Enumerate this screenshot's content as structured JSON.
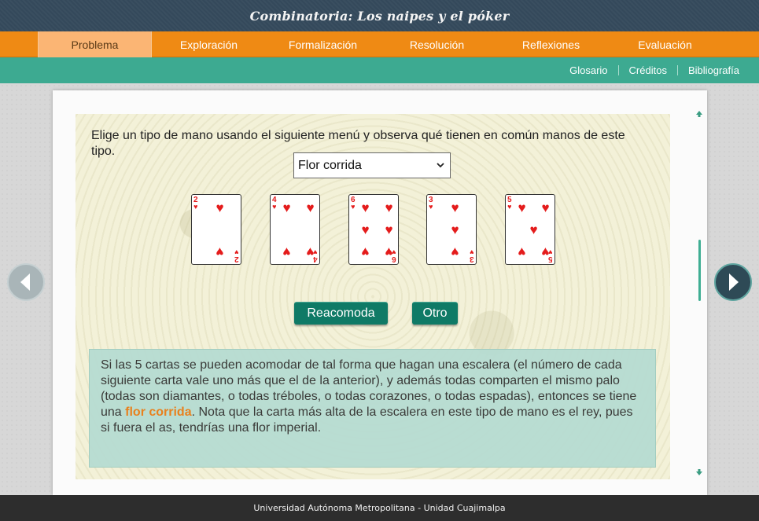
{
  "app": {
    "title": "Combinatoria: Los naipes y el póker"
  },
  "nav": {
    "tabs": [
      {
        "label": "Problema",
        "active": true
      },
      {
        "label": "Exploración",
        "active": false
      },
      {
        "label": "Formalización",
        "active": false
      },
      {
        "label": "Resolución",
        "active": false
      },
      {
        "label": "Reflexiones",
        "active": false
      },
      {
        "label": "Evaluación",
        "active": false
      }
    ]
  },
  "subnav": {
    "links": [
      "Glosario",
      "Créditos",
      "Bibliografía"
    ]
  },
  "content": {
    "instructions": "Elige un tipo de mano usando el siguiente menú y observa qué tienen en común manos de este tipo.",
    "hand_select": {
      "value": "Flor corrida"
    },
    "cards": [
      {
        "rank": "2",
        "suit": "hearts",
        "suit_glyph": "♥"
      },
      {
        "rank": "4",
        "suit": "hearts",
        "suit_glyph": "♥"
      },
      {
        "rank": "6",
        "suit": "hearts",
        "suit_glyph": "♥"
      },
      {
        "rank": "3",
        "suit": "hearts",
        "suit_glyph": "♥"
      },
      {
        "rank": "5",
        "suit": "hearts",
        "suit_glyph": "♥"
      }
    ],
    "buttons": {
      "reacomoda": "Reacomoda",
      "otro": "Otro"
    },
    "explanation": {
      "part1": "Si las 5 cartas se pueden acomodar de tal forma que hagan una escalera (el número de cada siguiente carta vale uno más que el de la anterior), y además todas comparten el mismo palo (todas son diamantes, o todas tréboles, o todas corazones, o todas espadas), entonces se tiene una ",
      "highlight": "flor corrida",
      "part2": ". Nota que la carta más alta de la escalera en este tipo de mano es el rey, pues si fuera el as, tendrías una flor imperial."
    }
  },
  "footer": {
    "text": "Universidad Autónoma Metropolitana - Unidad Cuajimalpa"
  },
  "colors": {
    "accent_orange": "#ef8a14",
    "teal": "#3daa91",
    "button": "#0f7a66",
    "highlight": "#e8780f",
    "heart_red": "#e41c1c"
  },
  "icons": {
    "prev": "chevron-left-icon",
    "next": "chevron-right-icon",
    "scroll_up": "arrow-up-icon",
    "scroll_down": "arrow-down-icon"
  }
}
